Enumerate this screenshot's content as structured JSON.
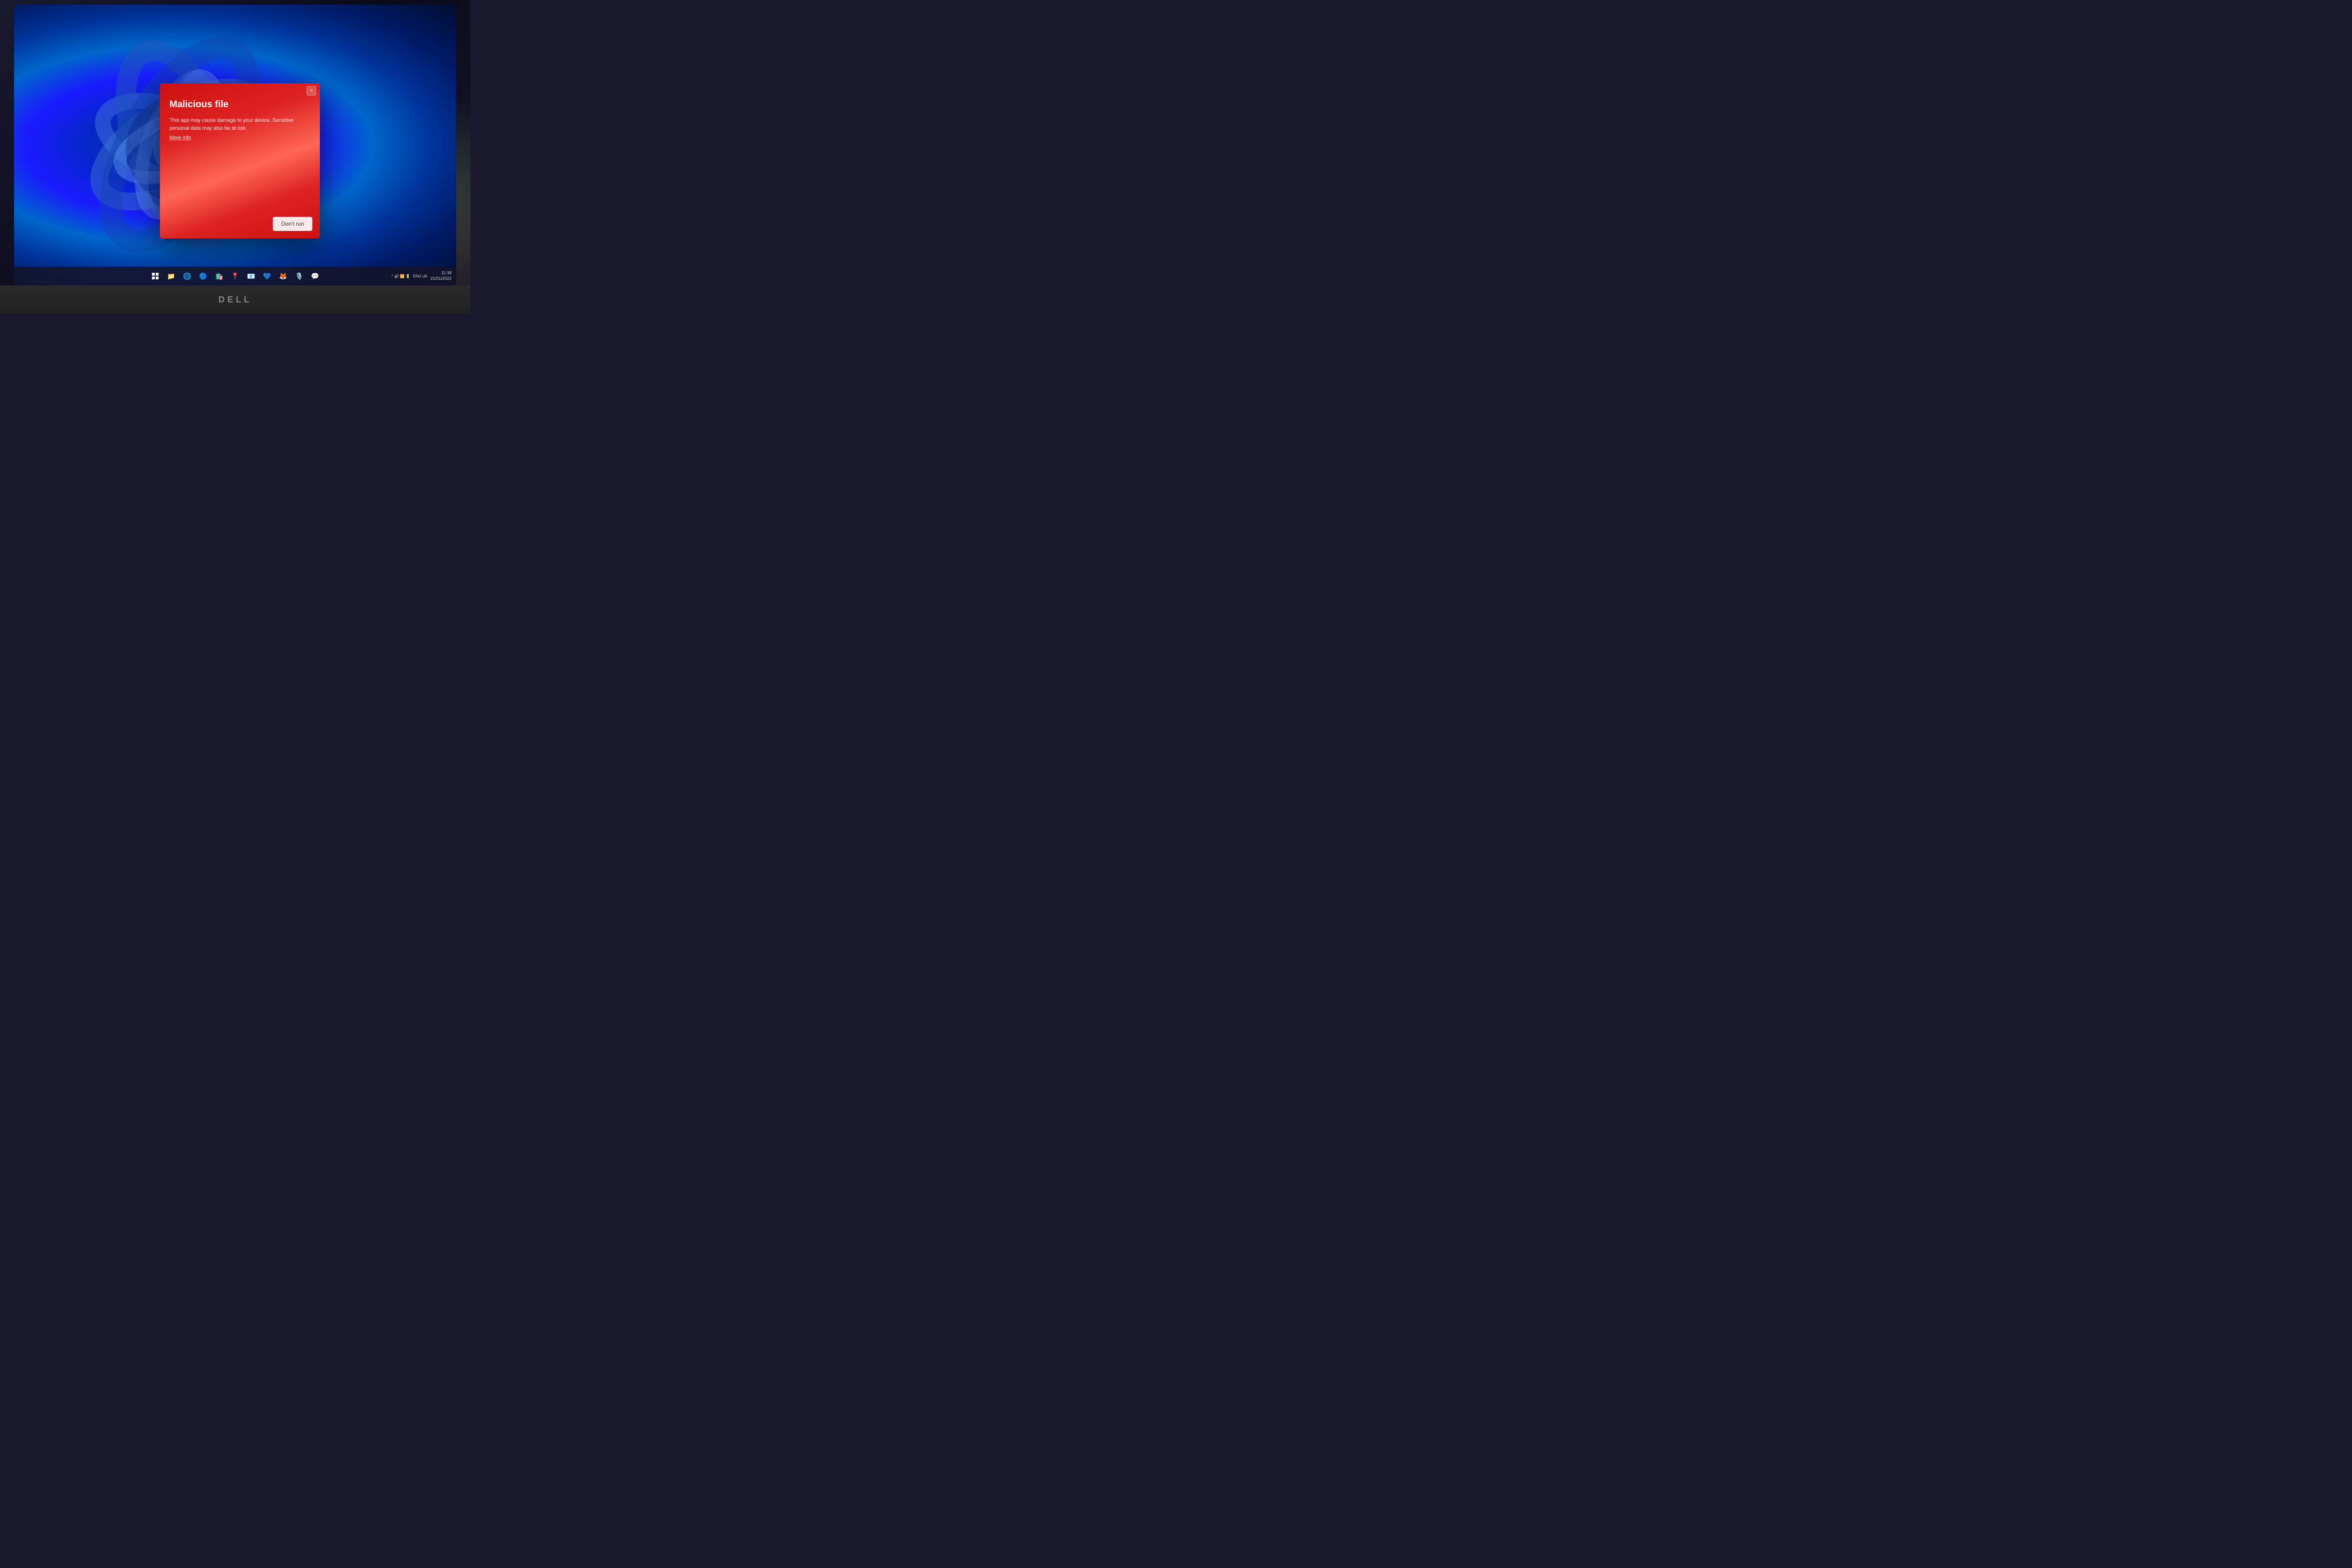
{
  "desktop": {
    "wallpaper": "Windows 11 bloom"
  },
  "dialog": {
    "title": "Malicious file",
    "body": "This app may cause damage to your device. Sensitive personal data may also be at risk.",
    "link_text": "More info",
    "close_label": "×",
    "dont_run_label": "Don't run"
  },
  "taskbar": {
    "time": "11:38",
    "date": "21/01/2022",
    "language": "ENG\nUK"
  },
  "laptop": {
    "brand": "DELL"
  }
}
